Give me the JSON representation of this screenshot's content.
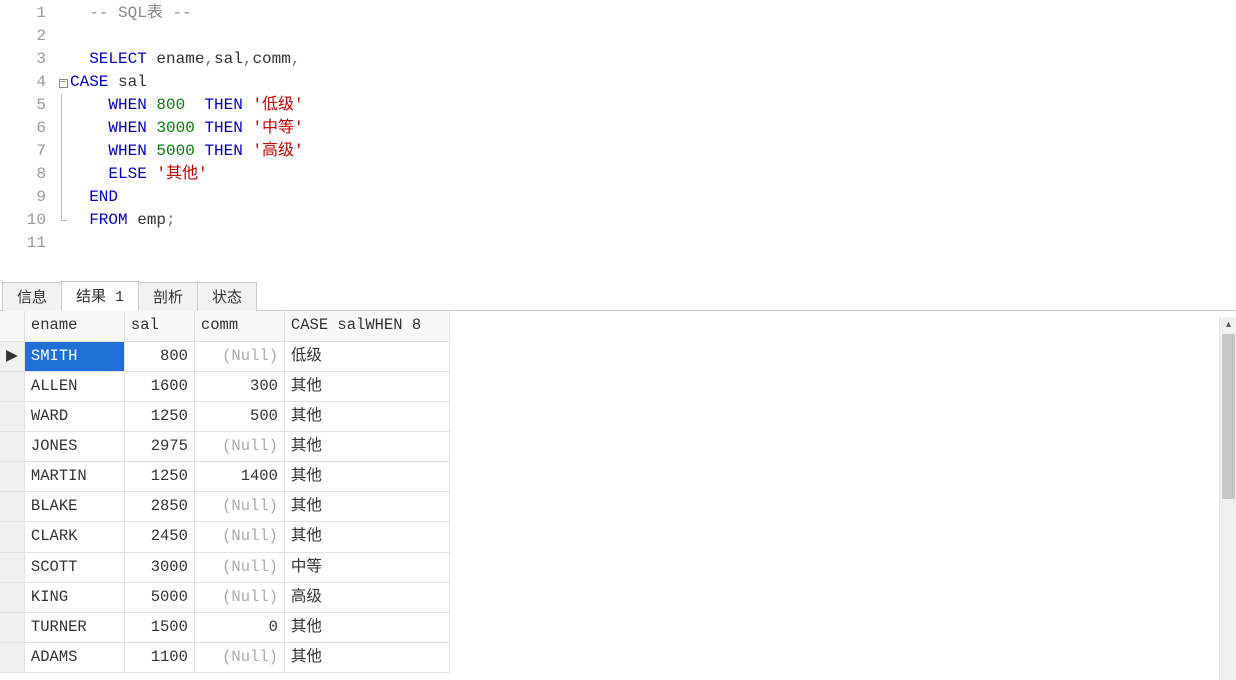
{
  "editor": {
    "lines": [
      {
        "num": "1",
        "fold": "",
        "tokens": [
          {
            "t": "  ",
            "c": ""
          },
          {
            "t": "-- SQL表 --",
            "c": "tok-comment"
          }
        ]
      },
      {
        "num": "2",
        "fold": "",
        "tokens": []
      },
      {
        "num": "3",
        "fold": "",
        "tokens": [
          {
            "t": "  ",
            "c": ""
          },
          {
            "t": "SELECT",
            "c": "tok-keyword"
          },
          {
            "t": " ename",
            "c": "tok-ident"
          },
          {
            "t": ",",
            "c": "tok-op"
          },
          {
            "t": "sal",
            "c": "tok-ident"
          },
          {
            "t": ",",
            "c": "tok-op"
          },
          {
            "t": "comm",
            "c": "tok-ident"
          },
          {
            "t": ",",
            "c": "tok-op"
          }
        ]
      },
      {
        "num": "4",
        "fold": "box",
        "tokens": [
          {
            "t": "CASE",
            "c": "tok-keyword"
          },
          {
            "t": " sal",
            "c": "tok-ident"
          }
        ]
      },
      {
        "num": "5",
        "fold": "line",
        "tokens": [
          {
            "t": "    ",
            "c": ""
          },
          {
            "t": "WHEN",
            "c": "tok-keyword"
          },
          {
            "t": " ",
            "c": ""
          },
          {
            "t": "800",
            "c": "tok-number"
          },
          {
            "t": "  ",
            "c": ""
          },
          {
            "t": "THEN",
            "c": "tok-keyword"
          },
          {
            "t": " ",
            "c": ""
          },
          {
            "t": "'低级'",
            "c": "tok-string"
          }
        ]
      },
      {
        "num": "6",
        "fold": "line",
        "tokens": [
          {
            "t": "    ",
            "c": ""
          },
          {
            "t": "WHEN",
            "c": "tok-keyword"
          },
          {
            "t": " ",
            "c": ""
          },
          {
            "t": "3000",
            "c": "tok-number"
          },
          {
            "t": " ",
            "c": ""
          },
          {
            "t": "THEN",
            "c": "tok-keyword"
          },
          {
            "t": " ",
            "c": ""
          },
          {
            "t": "'中等'",
            "c": "tok-string"
          }
        ]
      },
      {
        "num": "7",
        "fold": "line",
        "tokens": [
          {
            "t": "    ",
            "c": ""
          },
          {
            "t": "WHEN",
            "c": "tok-keyword"
          },
          {
            "t": " ",
            "c": ""
          },
          {
            "t": "5000",
            "c": "tok-number"
          },
          {
            "t": " ",
            "c": ""
          },
          {
            "t": "THEN",
            "c": "tok-keyword"
          },
          {
            "t": " ",
            "c": ""
          },
          {
            "t": "'高级'",
            "c": "tok-string"
          }
        ]
      },
      {
        "num": "8",
        "fold": "line",
        "tokens": [
          {
            "t": "    ",
            "c": ""
          },
          {
            "t": "ELSE",
            "c": "tok-keyword"
          },
          {
            "t": " ",
            "c": ""
          },
          {
            "t": "'其他'",
            "c": "tok-string"
          }
        ]
      },
      {
        "num": "9",
        "fold": "line",
        "tokens": [
          {
            "t": "  ",
            "c": ""
          },
          {
            "t": "END",
            "c": "tok-keyword"
          }
        ]
      },
      {
        "num": "10",
        "fold": "end",
        "tokens": [
          {
            "t": "  ",
            "c": ""
          },
          {
            "t": "FROM",
            "c": "tok-keyword"
          },
          {
            "t": " emp",
            "c": "tok-ident"
          },
          {
            "t": ";",
            "c": "tok-op"
          }
        ]
      },
      {
        "num": "11",
        "fold": "",
        "tokens": []
      }
    ]
  },
  "tabs": {
    "items": [
      {
        "label": "信息",
        "active": false
      },
      {
        "label": "结果 1",
        "active": true
      },
      {
        "label": "剖析",
        "active": false
      },
      {
        "label": "状态",
        "active": false
      }
    ]
  },
  "results": {
    "null_text": "(Null)",
    "columns": [
      "ename",
      "sal",
      "comm",
      "CASE salWHEN 8"
    ],
    "rows": [
      {
        "marker": "▶",
        "ename": "SMITH",
        "sal": "800",
        "comm": null,
        "case": "低级",
        "selected": true
      },
      {
        "marker": "",
        "ename": "ALLEN",
        "sal": "1600",
        "comm": "300",
        "case": "其他"
      },
      {
        "marker": "",
        "ename": "WARD",
        "sal": "1250",
        "comm": "500",
        "case": "其他"
      },
      {
        "marker": "",
        "ename": "JONES",
        "sal": "2975",
        "comm": null,
        "case": "其他"
      },
      {
        "marker": "",
        "ename": "MARTIN",
        "sal": "1250",
        "comm": "1400",
        "case": "其他"
      },
      {
        "marker": "",
        "ename": "BLAKE",
        "sal": "2850",
        "comm": null,
        "case": "其他"
      },
      {
        "marker": "",
        "ename": "CLARK",
        "sal": "2450",
        "comm": null,
        "case": "其他"
      },
      {
        "marker": "",
        "ename": "SCOTT",
        "sal": "3000",
        "comm": null,
        "case": "中等"
      },
      {
        "marker": "",
        "ename": "KING",
        "sal": "5000",
        "comm": null,
        "case": "高级"
      },
      {
        "marker": "",
        "ename": "TURNER",
        "sal": "1500",
        "comm": "0",
        "case": "其他"
      },
      {
        "marker": "",
        "ename": "ADAMS",
        "sal": "1100",
        "comm": null,
        "case": "其他"
      }
    ]
  }
}
